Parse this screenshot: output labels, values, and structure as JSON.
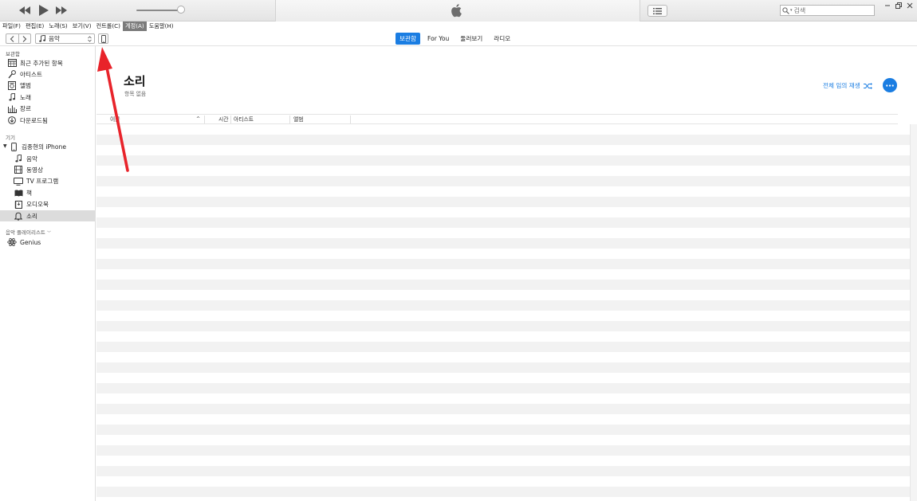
{
  "player": {
    "prev_icon": "rewind-icon",
    "play_icon": "play-icon",
    "next_icon": "fast-forward-icon",
    "volume_level": 0.9
  },
  "search": {
    "placeholder": "검색"
  },
  "menu": {
    "items": [
      {
        "label": "파일(F)"
      },
      {
        "label": "편집(E)"
      },
      {
        "label": "노래(S)"
      },
      {
        "label": "보기(V)"
      },
      {
        "label": "컨트롤(C)"
      },
      {
        "label": "계정(A)"
      },
      {
        "label": "도움말(H)"
      }
    ],
    "active_index": 5
  },
  "toolbar": {
    "media_select": "음악",
    "tabs": [
      {
        "label": "보관함",
        "active": true
      },
      {
        "label": "For You",
        "active": false
      },
      {
        "label": "둘러보기",
        "active": false
      },
      {
        "label": "라디오",
        "active": false
      }
    ]
  },
  "sidebar": {
    "library_header": "보관함",
    "library": [
      {
        "label": "최근 추가된 항목",
        "icon": "calendar-grid-icon"
      },
      {
        "label": "아티스트",
        "icon": "microphone-icon"
      },
      {
        "label": "앨범",
        "icon": "album-icon"
      },
      {
        "label": "노래",
        "icon": "music-note-icon"
      },
      {
        "label": "장르",
        "icon": "genre-icon"
      },
      {
        "label": "다운로드됨",
        "icon": "download-icon"
      }
    ],
    "devices_header": "기기",
    "device": {
      "label": "김종현의 iPhone",
      "icon": "iphone-icon"
    },
    "device_items": [
      {
        "label": "음악",
        "icon": "music-note-icon"
      },
      {
        "label": "동영상",
        "icon": "film-icon"
      },
      {
        "label": "TV 프로그램",
        "icon": "tv-icon"
      },
      {
        "label": "책",
        "icon": "book-icon"
      },
      {
        "label": "오디오북",
        "icon": "audiobook-icon"
      },
      {
        "label": "소리",
        "icon": "bell-icon",
        "selected": true
      }
    ],
    "playlists_header": "음악 플레이리스트",
    "playlists": [
      {
        "label": "Genius",
        "icon": "genius-atom-icon"
      }
    ]
  },
  "main": {
    "title": "소리",
    "subtitle": "항목 없음",
    "shuffle_label": "전체 임의 재생",
    "columns": [
      {
        "label": "이름"
      },
      {
        "label": "시간"
      },
      {
        "label": "아티스트"
      },
      {
        "label": "앨범"
      }
    ]
  },
  "colors": {
    "accent": "#1a7de2",
    "annotation_arrow": "#e8232a",
    "selected_row": "#dcdcdc"
  }
}
